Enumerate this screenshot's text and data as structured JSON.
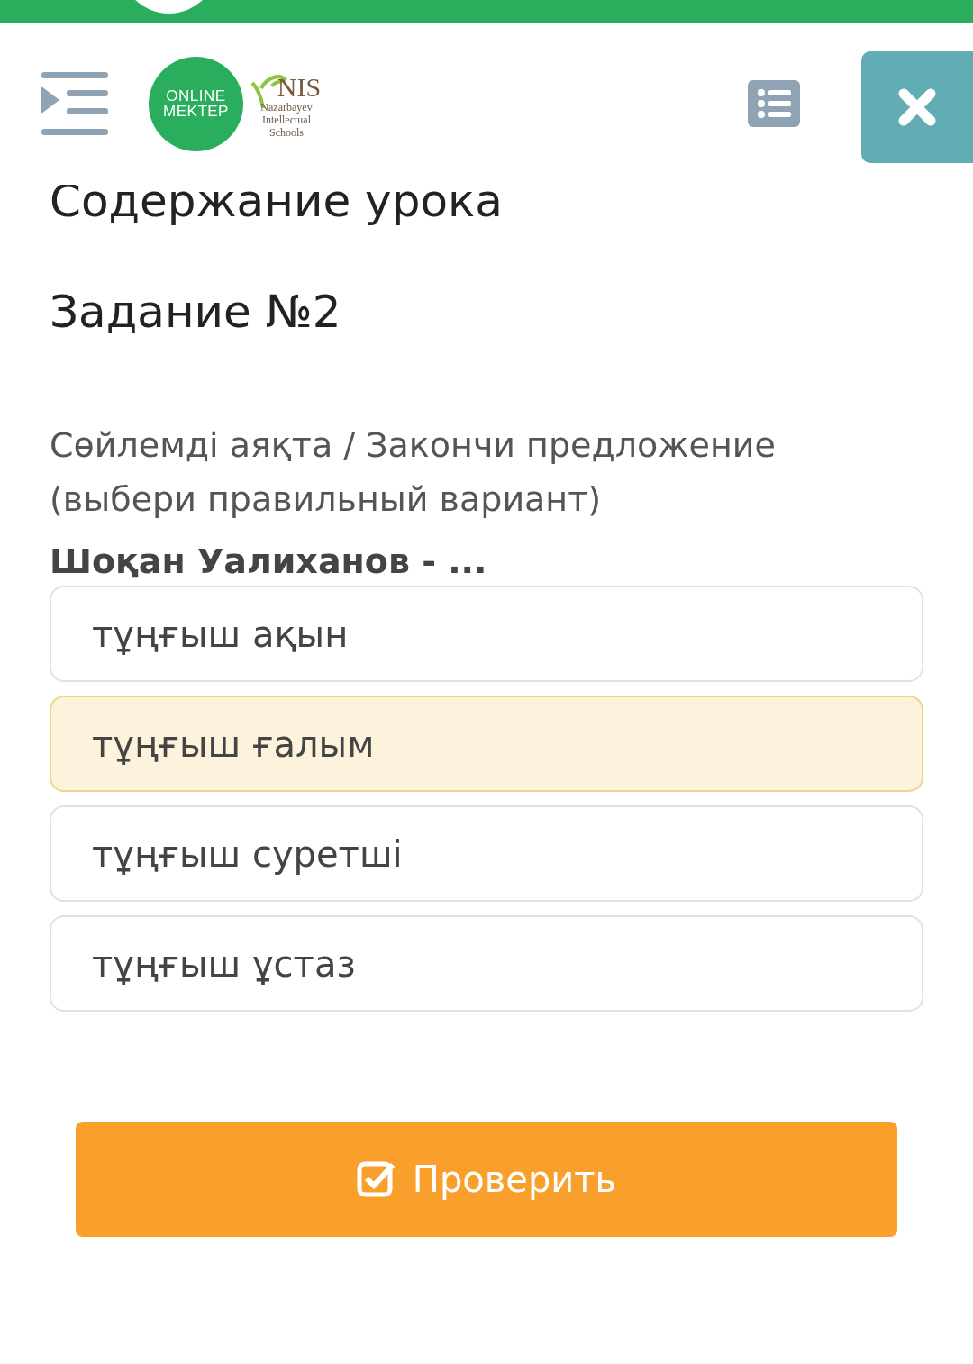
{
  "header": {
    "logo_text": [
      "ONLINE",
      "MEKTEP"
    ],
    "partner_logo": {
      "name": "NIS",
      "lines": [
        "Nazarbayev",
        "Intellectual",
        "Schools"
      ]
    }
  },
  "lesson_title": "Содержание урока",
  "task_title": "Задание №2",
  "instruction": "Сөйлемді аяқта / Закончи предложение (выбери правильный вариант)",
  "question": "Шоқан Уалиханов - ...",
  "options": [
    {
      "label": "тұңғыш ақын",
      "selected": false
    },
    {
      "label": "тұңғыш ғалым",
      "selected": true
    },
    {
      "label": "тұңғыш суретші",
      "selected": false
    },
    {
      "label": "тұңғыш ұстаз",
      "selected": false
    }
  ],
  "check_button": {
    "label": "Проверить"
  }
}
